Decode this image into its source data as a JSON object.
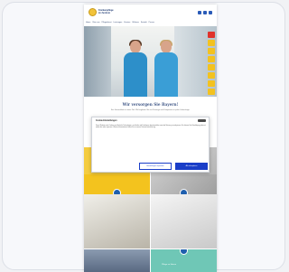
{
  "site": {
    "logo_text": "Krankenpflege im Zentrum",
    "nav": [
      "Home",
      "Über uns",
      "Pflegedienst",
      "Leistungen",
      "Karriere",
      "Wohnen",
      "Kontakt",
      "Presse"
    ],
    "social_icons": [
      "facebook-icon",
      "instagram-icon",
      "youtube-icon"
    ]
  },
  "hero": {
    "side_buttons": [
      "phone-icon",
      "mail-icon",
      "map-icon",
      "calendar-icon",
      "user-icon",
      "info-icon",
      "search-icon",
      "menu-icon"
    ]
  },
  "main": {
    "slogan": "Wir versorgen Sie Bayern!",
    "subtitle": "Ihre Gesundheit ist unser Ziel. Wir begleiten Sie mit Fürsorge und Kompetenz in jeder Lebenslage."
  },
  "cookie": {
    "title": "Cookie-Einstellungen",
    "body": "Diese Website nutzt Cookies und ähnliche Technologien, um Inhalte und Funktionen bereitzustellen sowie die Nutzung zu analysieren. Sie können Ihre Einwilligung jederzeit widerrufen oder anpassen. Weitere Informationen finden Sie in unserer Datenschutzerklärung.",
    "close_label": "Schließen",
    "settings_label": "Einstellungen anpassen",
    "accept_label": "Alle akzeptieren"
  },
  "tiles": {
    "t6_text": "Pflege zu Hause"
  },
  "colors": {
    "accent_yellow": "#f3c31e",
    "primary_blue": "#1a3ec8",
    "teal": "#6fc7b6"
  }
}
